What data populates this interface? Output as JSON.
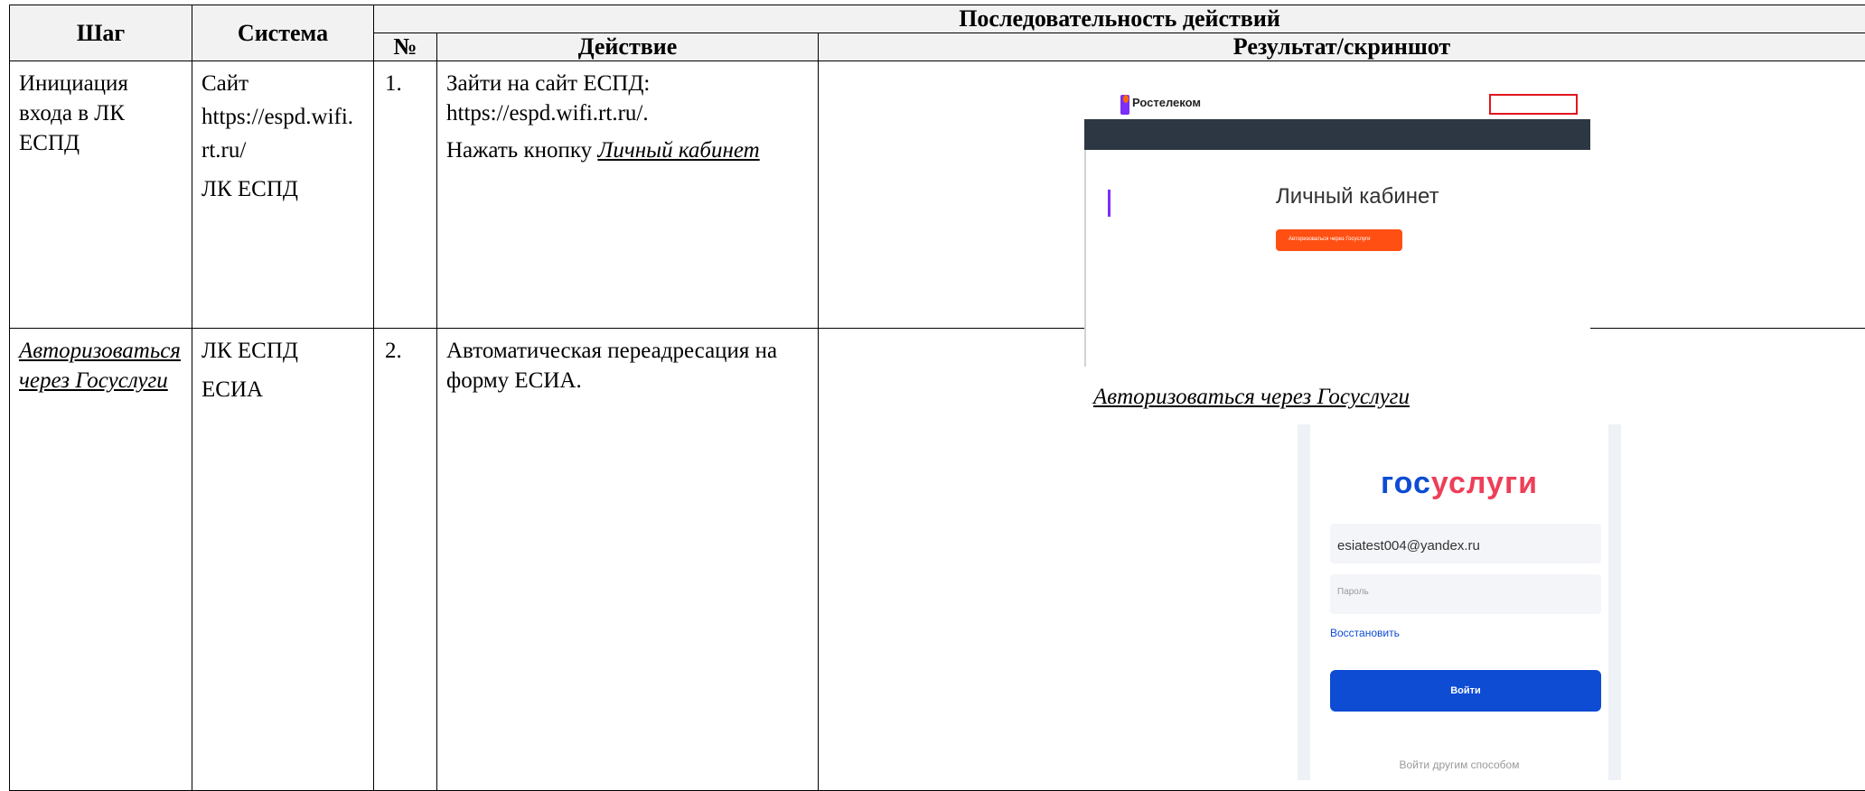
{
  "table": {
    "headers": {
      "step": "Шаг",
      "system": "Система",
      "sequence": "Последовательность действий",
      "num": "№",
      "action": "Действие",
      "result": "Результат/скриншот"
    },
    "rows": [
      {
        "step": "Инициация входа в ЛК ЕСПД",
        "system_lines": [
          "Сайт",
          "https://espd.wifi.",
          "rt.ru/",
          "ЛК ЕСПД"
        ],
        "num": "1.",
        "action_lines": [
          "Зайти на сайт ЕСПД:",
          "https://espd.wifi.rt.ru/."
        ],
        "action_press": "Нажать кнопку ",
        "action_link": "Личный кабинет",
        "caption": "Авторизоваться через Госуслуги"
      },
      {
        "step_link": "Авторизоваться через Госуслуги",
        "system_lines": [
          "ЛК ЕСПД",
          "ЕСИА"
        ],
        "num": "2.",
        "action": "Автоматическая переадресация на форму ЕСИА."
      }
    ]
  },
  "screenshot1": {
    "logo": "Ростелеком",
    "title": "Личный кабинет",
    "button": "Авторизоваться через Госуслуги",
    "highlight_color": "#e2161f",
    "accent_color": "#ff4f12"
  },
  "screenshot2": {
    "brand_part1": "гос",
    "brand_part2": "услуги",
    "login_value": "esiatest004@yandex.ru",
    "password_placeholder": "Пароль",
    "restore": "Восстановить",
    "login_button": "Войти",
    "other": "Войти другим способом",
    "brand_color": "#0d4cd3"
  }
}
